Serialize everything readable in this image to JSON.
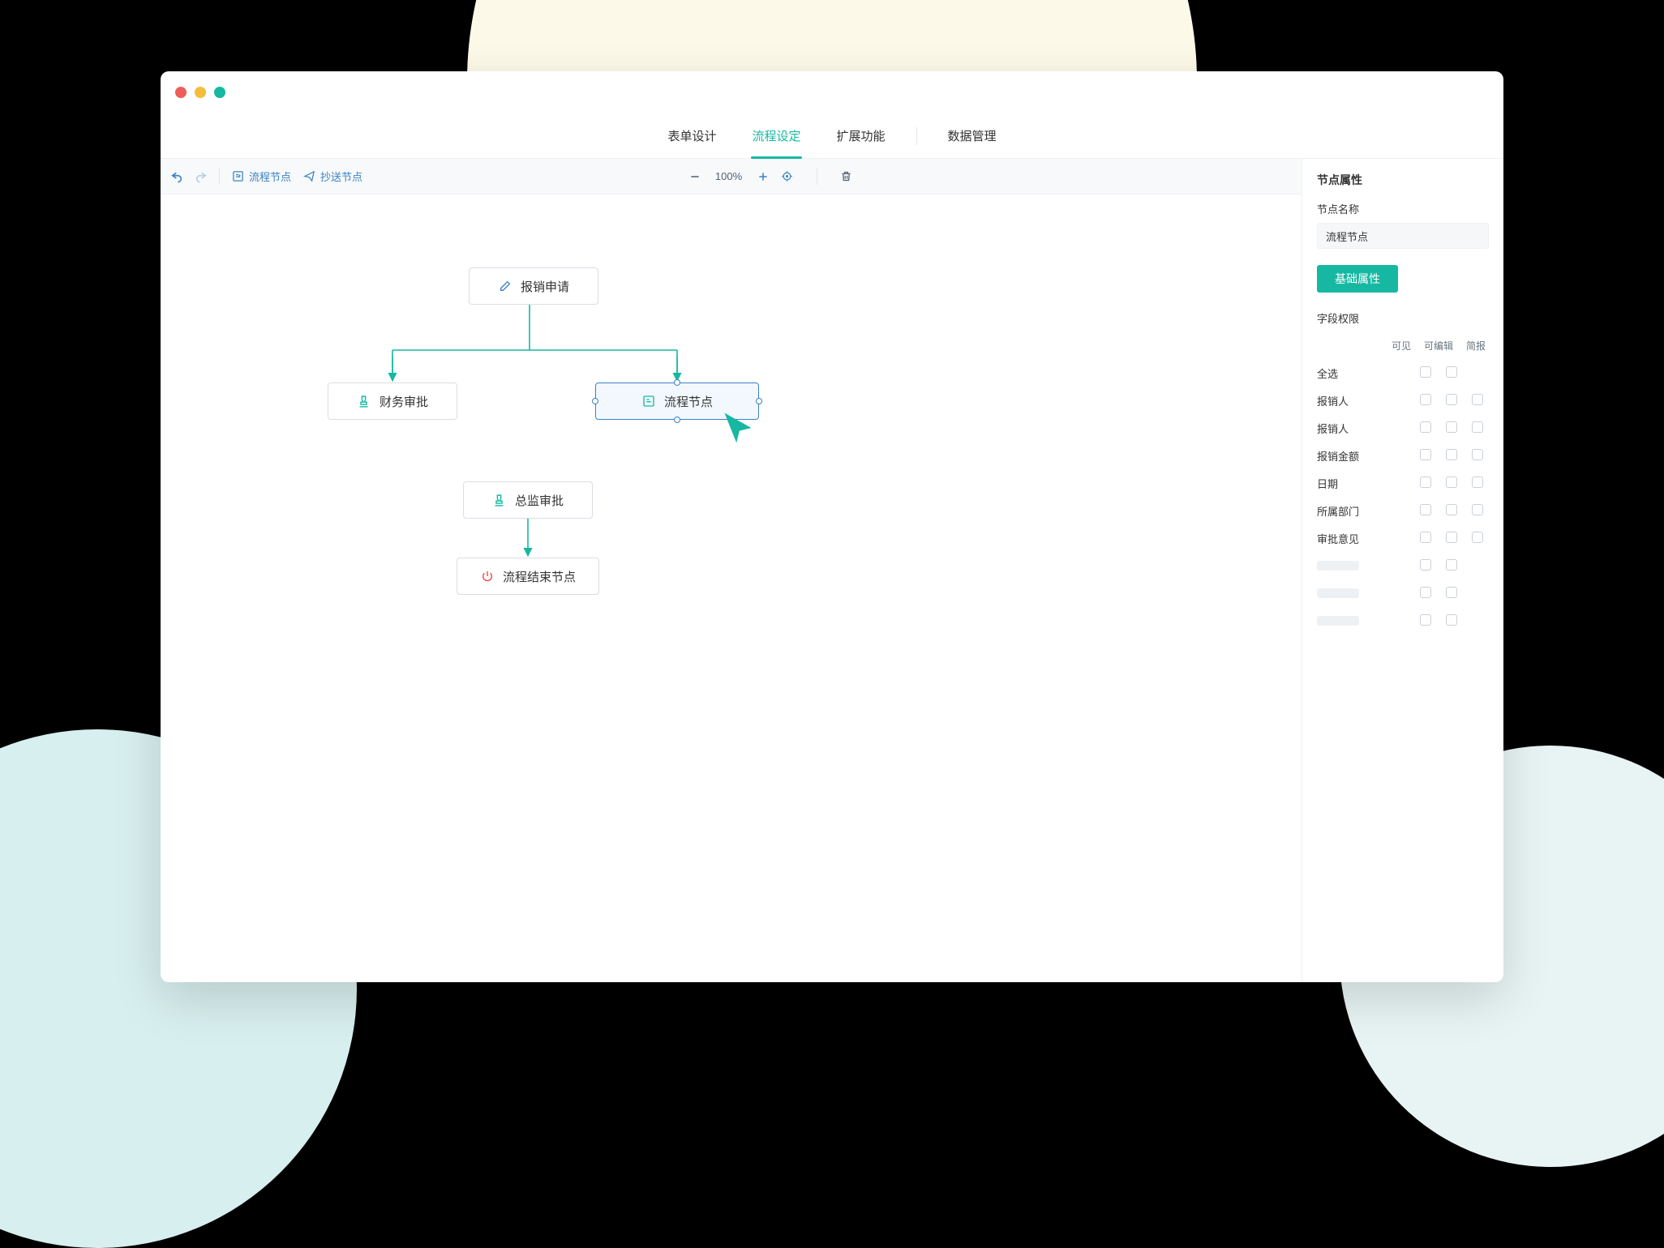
{
  "tabs": {
    "form_design": "表单设计",
    "flow_settings": "流程设定",
    "extensions": "扩展功能",
    "data_mgmt": "数据管理",
    "active": "flow_settings"
  },
  "toolbar": {
    "flow_node": "流程节点",
    "cc_node": "抄送节点",
    "zoom": "100%"
  },
  "nodes": {
    "start": "报销申请",
    "finance": "财务审批",
    "flow": "流程节点",
    "director": "总监审批",
    "end": "流程结束节点"
  },
  "panel": {
    "title": "节点属性",
    "name_label": "节点名称",
    "name_value": "流程节点",
    "basic_btn": "基础属性",
    "perm_title": "字段权限",
    "cols": {
      "visible": "可见",
      "editable": "可编辑",
      "brief": "简报"
    },
    "rows": [
      {
        "name": "全选",
        "cols": 2
      },
      {
        "name": "报销人",
        "cols": 3
      },
      {
        "name": "报销人",
        "cols": 3
      },
      {
        "name": "报销金额",
        "cols": 3
      },
      {
        "name": "日期",
        "cols": 3
      },
      {
        "name": "所属部门",
        "cols": 3
      },
      {
        "name": "审批意见",
        "cols": 3
      },
      {
        "name": "",
        "cols": 2,
        "placeholder": true
      },
      {
        "name": "",
        "cols": 2,
        "placeholder": true
      },
      {
        "name": "",
        "cols": 2,
        "placeholder": true
      }
    ]
  }
}
